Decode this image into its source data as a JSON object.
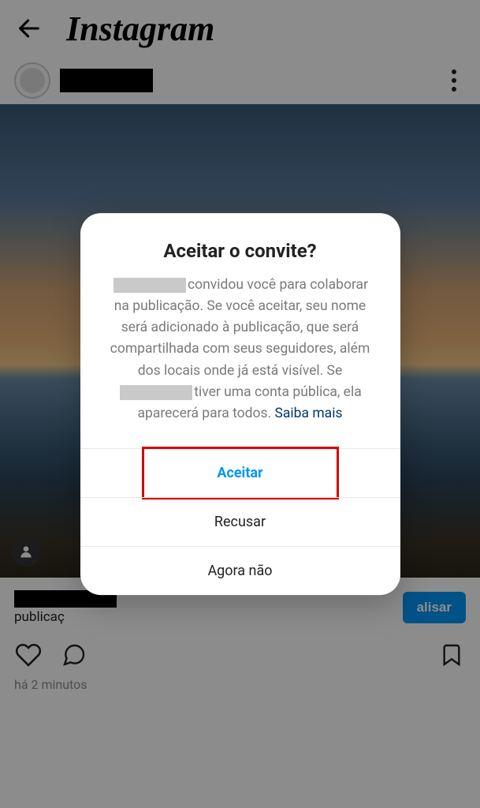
{
  "header": {
    "logo": "Instagram"
  },
  "post": {
    "caption_fragment": "publicaç",
    "cta_label_fragment": "alisar",
    "timestamp": "há 2 minutos"
  },
  "dialog": {
    "title": "Aceitar o convite?",
    "body_part1": "convidou você para colaborar na publicação. Se você aceitar, seu nome será adicionado à publicação, que será compartilhada com seus seguidores, além dos locais onde já está visível. Se",
    "body_part2": "tiver uma conta pública, ela aparecerá para todos.",
    "learn_more": "Saiba mais",
    "accept": "Aceitar",
    "decline": "Recusar",
    "not_now": "Agora não"
  }
}
